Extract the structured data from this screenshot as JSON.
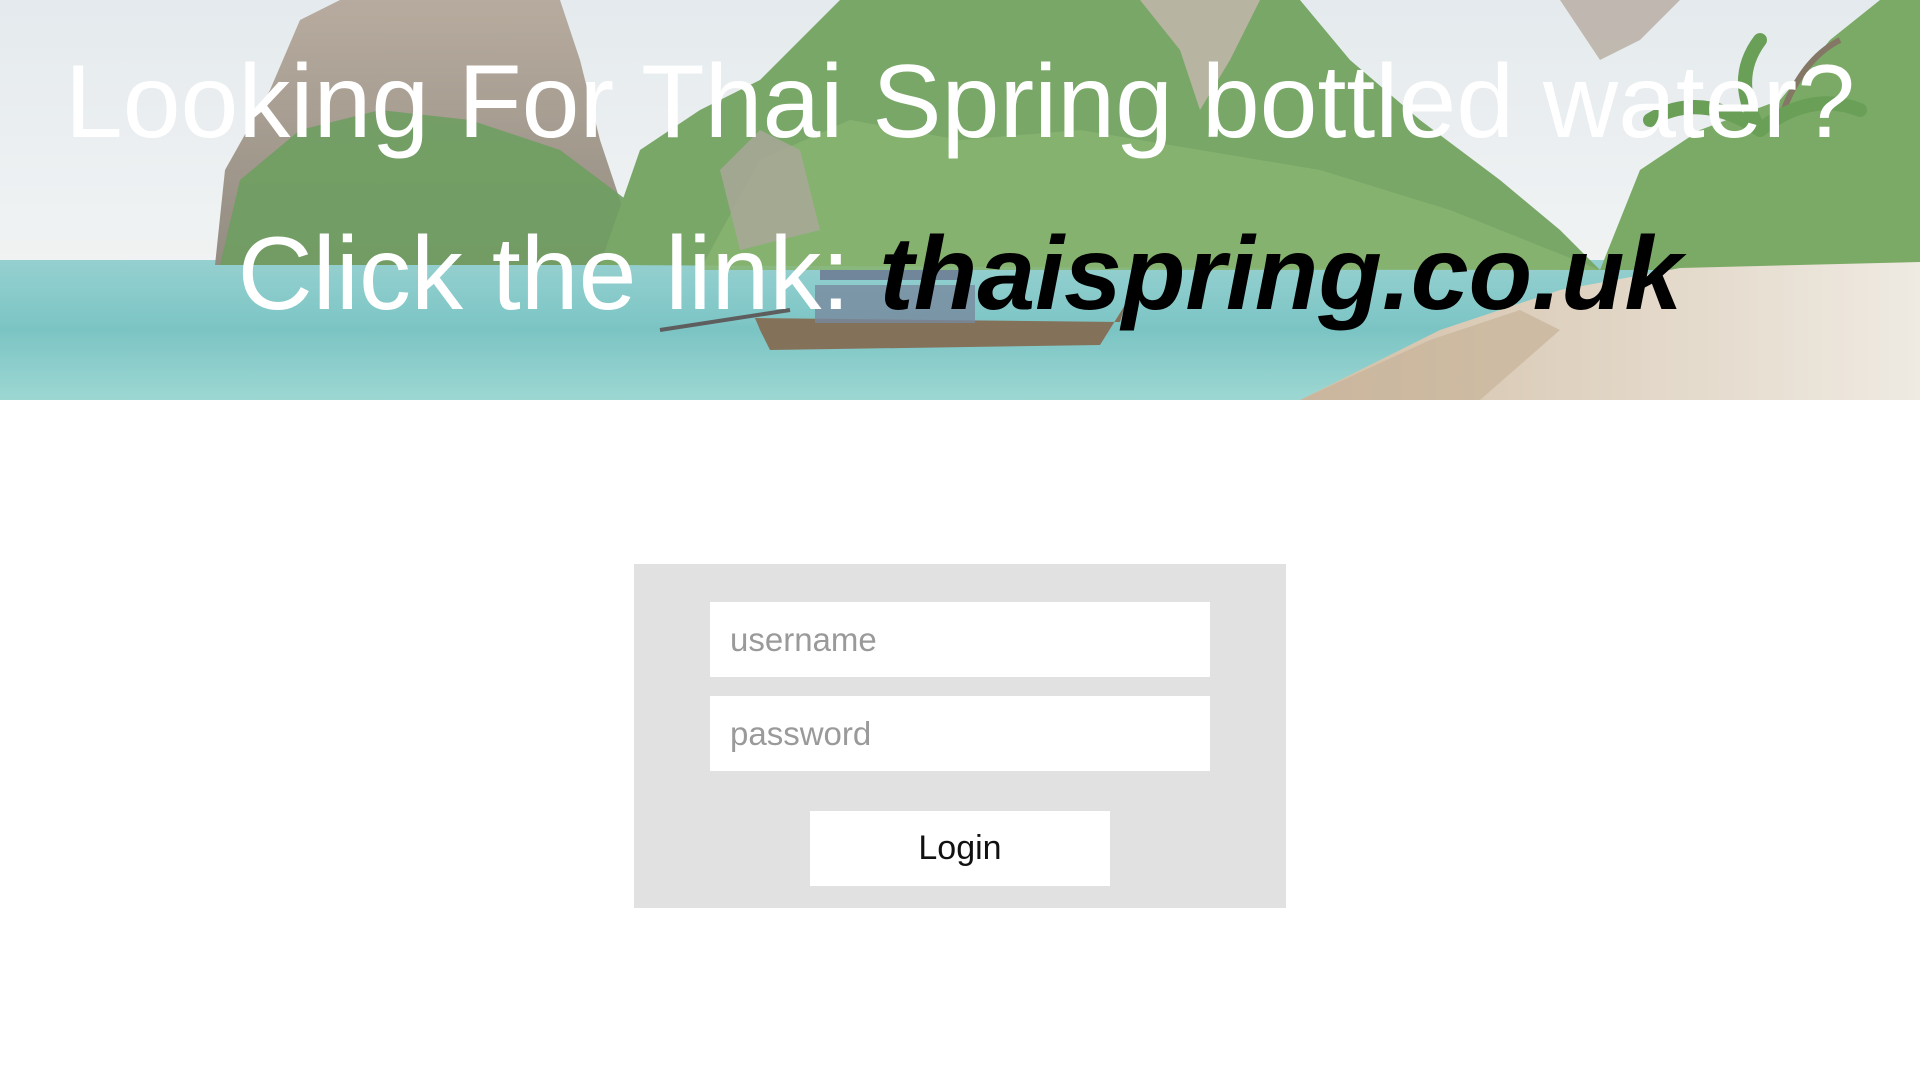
{
  "banner": {
    "headline_line1": "Looking For Thai Spring bottled water?",
    "headline_line2_prefix": "Click the link: ",
    "headline_line2_link": "thaispring.co.uk",
    "image_subject": "tropical-beach-with-longtail-boat"
  },
  "login": {
    "username_placeholder": "username",
    "password_placeholder": "password",
    "button_label": "Login"
  },
  "colors": {
    "page_background": "#ffffff",
    "panel_background": "#e1e1e1",
    "headline_text": "#ffffff",
    "link_text": "#000000"
  }
}
